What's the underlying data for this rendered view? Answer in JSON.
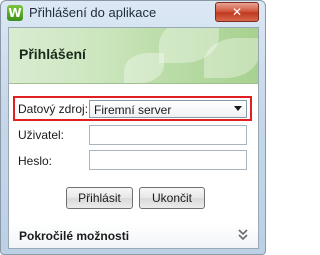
{
  "window": {
    "title": "Přihlášení do aplikace",
    "app_icon_letter": "W",
    "close_glyph": "✕"
  },
  "banner": {
    "title": "Přihlášení"
  },
  "form": {
    "datasource_label": "Datový zdroj:",
    "datasource_value": "Firemní server",
    "user_label": "Uživatel:",
    "user_value": "",
    "password_label": "Heslo:",
    "password_value": ""
  },
  "buttons": {
    "login": "Přihlásit",
    "exit": "Ukončit"
  },
  "footer": {
    "advanced_label": "Pokročilé možnosti",
    "expand_icon": "double-chevron-down-icon"
  },
  "colors": {
    "highlight": "#e02020",
    "app_icon_green": "#5aa82a",
    "close_red": "#c8432a"
  }
}
